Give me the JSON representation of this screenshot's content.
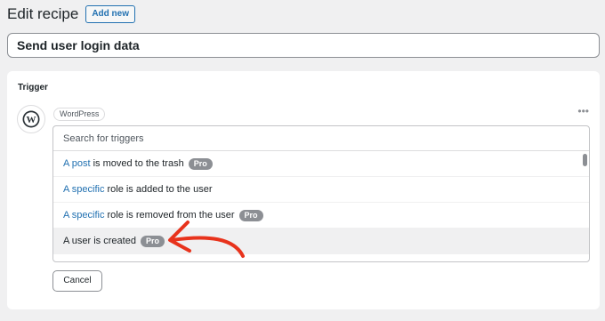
{
  "header": {
    "title": "Edit recipe",
    "add_new_label": "Add new"
  },
  "recipe_title": "Send user login data",
  "trigger": {
    "heading": "Trigger",
    "integration": "WordPress",
    "logo_icon": "wordpress-logo-icon",
    "more_icon": "more-dots-icon",
    "search_placeholder": "Search for triggers",
    "options": [
      {
        "link": "A post",
        "rest": "is moved to the trash",
        "badge": "Pro"
      },
      {
        "link": "A specific",
        "rest": "role is added to the user",
        "badge": ""
      },
      {
        "link": "A specific",
        "rest": "role is removed from the user",
        "badge": "Pro"
      },
      {
        "link": "",
        "rest": "A user is created",
        "badge": "Pro"
      }
    ],
    "cancel_label": "Cancel"
  },
  "annotation": {
    "arrow_icon": "red-arrow-icon",
    "arrow_color": "#e8331c"
  },
  "colors": {
    "link": "#2271b1",
    "pro_badge": "#8c8f94",
    "background": "#f0f0f1"
  }
}
